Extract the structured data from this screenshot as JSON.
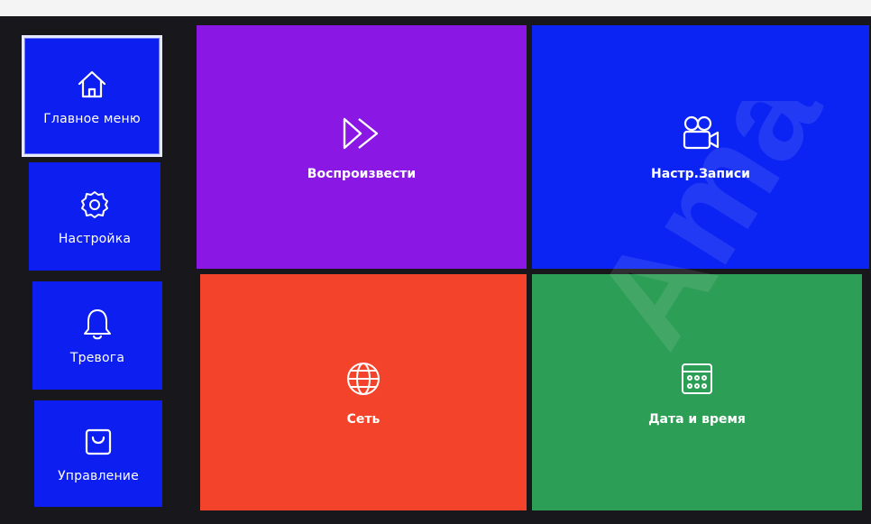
{
  "sidebar": {
    "items": [
      {
        "label": "Главное меню",
        "icon": "home-icon",
        "active": true
      },
      {
        "label": "Настройка",
        "icon": "gear-icon",
        "active": false
      },
      {
        "label": "Тревога",
        "icon": "bell-icon",
        "active": false
      },
      {
        "label": "Управление",
        "icon": "bag-icon",
        "active": false
      }
    ]
  },
  "tiles": [
    {
      "label": "Воспроизвести",
      "icon": "fast-forward-icon",
      "color": "#8a17e3"
    },
    {
      "label": "Настр.Записи",
      "icon": "video-camera-icon",
      "color": "#0b24f3"
    },
    {
      "label": "Сеть",
      "icon": "globe-icon",
      "color": "#f3442b"
    },
    {
      "label": "Дата и время",
      "icon": "calendar-icon",
      "color": "#2d9e55"
    }
  ],
  "colors": {
    "sidebar_blue": "#0d1ff0",
    "purple": "#8a17e3",
    "blue": "#0b24f3",
    "red": "#f3442b",
    "green": "#2d9e55"
  },
  "watermark": {
    "text": "Amatek"
  }
}
